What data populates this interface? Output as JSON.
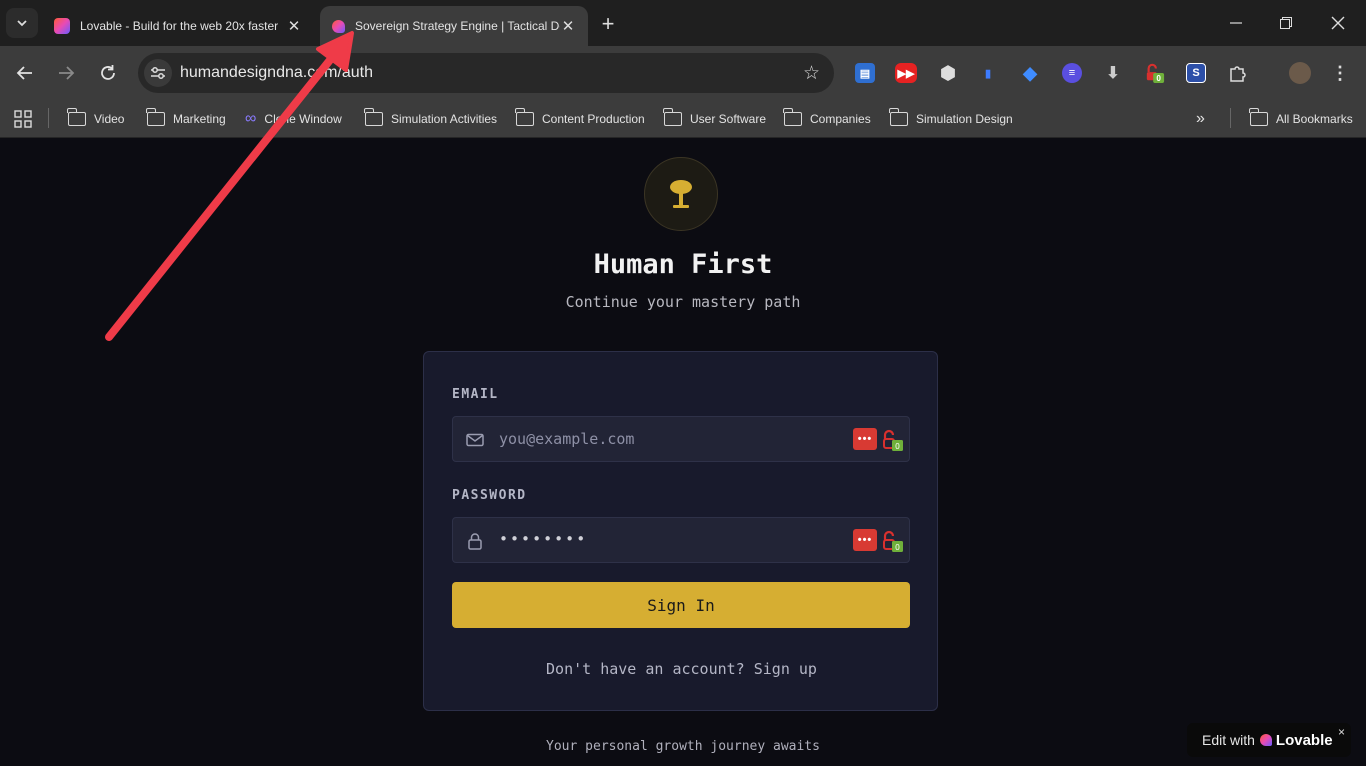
{
  "browser": {
    "tabs": [
      {
        "title": "Lovable - Build for the web 20x faster",
        "active": false
      },
      {
        "title": "Sovereign Strategy Engine | Tactical Dec",
        "active": true
      }
    ],
    "url": "humandesigndna.com/auth",
    "bookmarks": [
      "Video",
      "Marketing",
      "Clone Window",
      "Simulation Activities",
      "Content Production",
      "User Software",
      "Companies",
      "Simulation Design"
    ],
    "all_bookmarks_label": "All Bookmarks",
    "extension_badge": "0"
  },
  "page": {
    "title": "Human First",
    "subtitle": "Continue your mastery path",
    "email_label": "EMAIL",
    "email_placeholder": "you@example.com",
    "password_label": "PASSWORD",
    "password_value": "••••••••",
    "password_manager_badge": "0",
    "signin_label": "Sign In",
    "signup_prompt": "Don't have an account?",
    "signup_link": "Sign up",
    "footer": "Your personal growth journey awaits"
  },
  "badge": {
    "prefix": "Edit with",
    "brand": "Lovable",
    "close": "×"
  },
  "colors": {
    "accent": "#d6ae32",
    "card": "#181a2c",
    "background": "#0c0c12",
    "annotation_arrow": "#ef3b48"
  }
}
